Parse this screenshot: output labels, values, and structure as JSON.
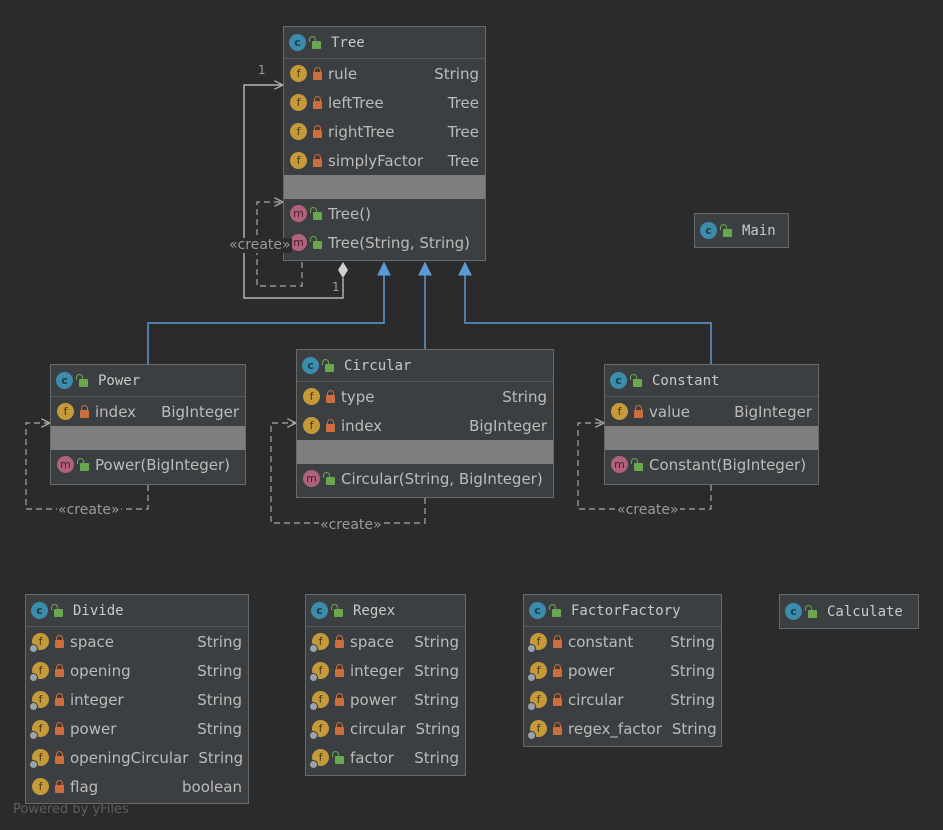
{
  "classes": {
    "tree": {
      "name": "Tree",
      "fields": [
        {
          "name": "rule",
          "type": "String"
        },
        {
          "name": "leftTree",
          "type": "Tree"
        },
        {
          "name": "rightTree",
          "type": "Tree"
        },
        {
          "name": "simplyFactor",
          "type": "Tree"
        }
      ],
      "methods": [
        {
          "name": "Tree()"
        },
        {
          "name": "Tree(String, String)"
        }
      ]
    },
    "main": {
      "name": "Main"
    },
    "power": {
      "name": "Power",
      "fields": [
        {
          "name": "index",
          "type": "BigInteger"
        }
      ],
      "methods": [
        {
          "name": "Power(BigInteger)"
        }
      ]
    },
    "circular": {
      "name": "Circular",
      "fields": [
        {
          "name": "type",
          "type": "String"
        },
        {
          "name": "index",
          "type": "BigInteger"
        }
      ],
      "methods": [
        {
          "name": "Circular(String, BigInteger)"
        }
      ]
    },
    "constant": {
      "name": "Constant",
      "fields": [
        {
          "name": "value",
          "type": "BigInteger"
        }
      ],
      "methods": [
        {
          "name": "Constant(BigInteger)"
        }
      ]
    },
    "divide": {
      "name": "Divide",
      "fields": [
        {
          "name": "space",
          "type": "String"
        },
        {
          "name": "opening",
          "type": "String"
        },
        {
          "name": "integer",
          "type": "String"
        },
        {
          "name": "power",
          "type": "String"
        },
        {
          "name": "openingCircular",
          "type": "String"
        },
        {
          "name": "flag",
          "type": "boolean"
        }
      ]
    },
    "regex": {
      "name": "Regex",
      "fields": [
        {
          "name": "space",
          "type": "String"
        },
        {
          "name": "integer",
          "type": "String"
        },
        {
          "name": "power",
          "type": "String"
        },
        {
          "name": "circular",
          "type": "String"
        },
        {
          "name": "factor",
          "type": "String"
        }
      ]
    },
    "factorFactory": {
      "name": "FactorFactory",
      "fields": [
        {
          "name": "constant",
          "type": "String"
        },
        {
          "name": "power",
          "type": "String"
        },
        {
          "name": "circular",
          "type": "String"
        },
        {
          "name": "regex_factor",
          "type": "String"
        }
      ]
    },
    "calculate": {
      "name": "Calculate"
    }
  },
  "labels": {
    "create": "«create»",
    "multiplicity_one": "1"
  },
  "watermark": "Powered by yFiles",
  "icons": {
    "class": "class-icon",
    "field": "field-icon",
    "static_field": "static-field-icon",
    "method": "method-icon",
    "private": "lock-icon",
    "public": "unlock-icon"
  },
  "colors": {
    "background": "#2b2b2b",
    "inheritance_arrow": "#5b9bd5",
    "edge": "#a9a9a9"
  }
}
